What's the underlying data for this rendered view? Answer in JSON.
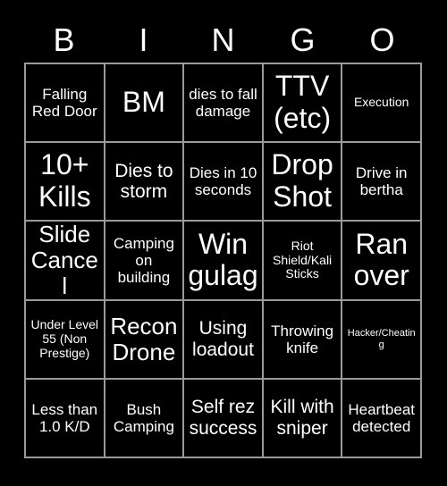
{
  "card": {
    "title": "BINGO",
    "header_letters": [
      "B",
      "I",
      "N",
      "G",
      "O"
    ],
    "background_color": "#000000",
    "text_color": "#FFFFFF",
    "gridline_color": "#9A9A9A",
    "rows": 5,
    "columns": 5,
    "cells": [
      {
        "text": "Falling Red Door",
        "size": "m"
      },
      {
        "text": "BM",
        "size": "xxl"
      },
      {
        "text": "dies to fall damage",
        "size": "m"
      },
      {
        "text": "TTV (etc)",
        "size": "xxl"
      },
      {
        "text": "Execution",
        "size": "s"
      },
      {
        "text": "10+ Kills",
        "size": "xxl"
      },
      {
        "text": "Dies to storm",
        "size": "l"
      },
      {
        "text": "Dies in 10 seconds",
        "size": "m"
      },
      {
        "text": "Drop Shot",
        "size": "xxl"
      },
      {
        "text": "Drive in bertha",
        "size": "m"
      },
      {
        "text": "Slide Cancel",
        "size": "xl"
      },
      {
        "text": "Camping on building",
        "size": "m"
      },
      {
        "text": "Win gulag",
        "size": "xxl"
      },
      {
        "text": "Riot Shield/Kali Sticks",
        "size": "s"
      },
      {
        "text": "Ran over",
        "size": "xxl"
      },
      {
        "text": "Under Level 55 (Non Prestige)",
        "size": "s"
      },
      {
        "text": "Recon Drone",
        "size": "xl"
      },
      {
        "text": "Using loadout",
        "size": "l"
      },
      {
        "text": "Throwing knife",
        "size": "m"
      },
      {
        "text": "Hacker/Cheating",
        "size": "xs"
      },
      {
        "text": "Less than 1.0 K/D",
        "size": "m"
      },
      {
        "text": "Bush Camping",
        "size": "m"
      },
      {
        "text": "Self rez success",
        "size": "l"
      },
      {
        "text": "Kill with sniper",
        "size": "l"
      },
      {
        "text": "Heartbeat detected",
        "size": "m"
      }
    ]
  }
}
